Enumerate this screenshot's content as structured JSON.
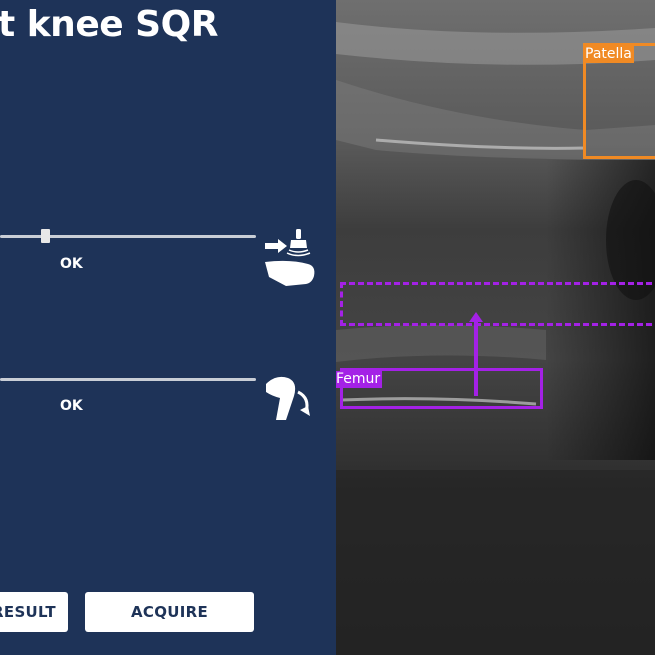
{
  "title": "t knee SQR",
  "probe_position": {
    "status": "OK",
    "slider_value": 0.18
  },
  "knee_flexion": {
    "status": "OK"
  },
  "buttons": {
    "result_label": "RESULT",
    "acquire_label": "ACQUIRE"
  },
  "annotations": {
    "patella": {
      "label": "Patella",
      "color": "#f08a24"
    },
    "femur": {
      "label": "Femur",
      "color": "#a421e6"
    },
    "target_region": {
      "color": "#a421e6",
      "style": "dashed"
    }
  },
  "colors": {
    "panel_background": "#1e3358",
    "text": "#ffffff",
    "button_text": "#1e3358"
  }
}
